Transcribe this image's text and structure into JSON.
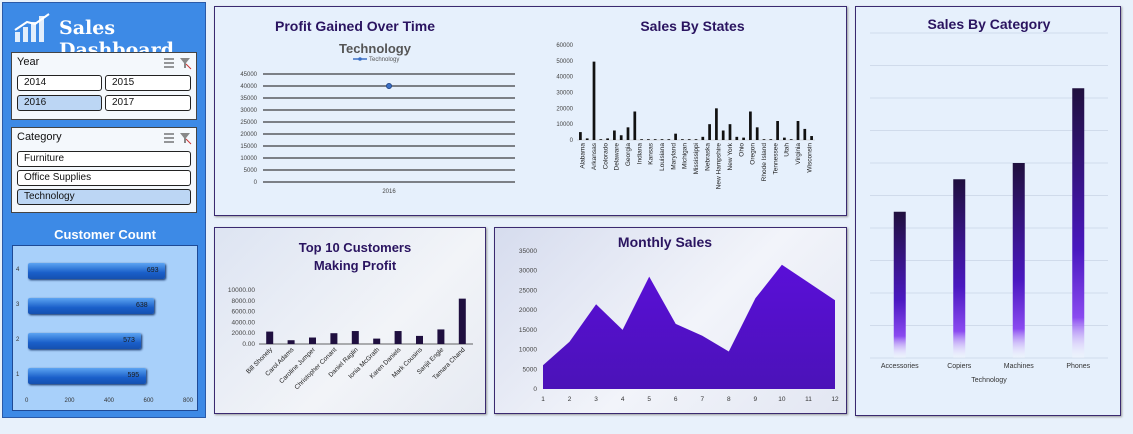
{
  "sidebar": {
    "title": "Sales Dashboard",
    "year_slicer": {
      "label": "Year",
      "items": [
        "2014",
        "2015",
        "2016",
        "2017"
      ],
      "selected": "2016"
    },
    "category_slicer": {
      "label": "Category",
      "items": [
        "Furniture",
        "Office Supplies",
        "Technology"
      ],
      "selected": "Technology"
    },
    "customer_count_title": "Customer Count"
  },
  "charts": {
    "customer_count": {
      "type": "bar",
      "orientation": "horizontal",
      "categories": [
        "4",
        "3",
        "2",
        "1"
      ],
      "values": [
        693,
        638,
        573,
        595
      ],
      "xticks": [
        "0",
        "200",
        "400",
        "600",
        "800"
      ],
      "xlim": [
        0,
        800
      ]
    },
    "profit_over_time": {
      "type": "line",
      "title": "Profit Gained Over Time",
      "chart_title": "Technology",
      "legend": "Technology",
      "x": [
        "2016"
      ],
      "values": [
        40000
      ],
      "ylim": [
        0,
        45000
      ],
      "yticks": [
        "45000",
        "40000",
        "35000",
        "30000",
        "25000",
        "20000",
        "15000",
        "10000",
        "5000",
        "0"
      ]
    },
    "sales_by_states": {
      "type": "bar",
      "title": "Sales By States",
      "ylim": [
        0,
        60000
      ],
      "yticks": [
        "60000",
        "50000",
        "40000",
        "30000",
        "20000",
        "10000",
        "0"
      ],
      "labels": [
        "Alabama",
        "Arkansas",
        "Colorado",
        "Delaware",
        "Georgia",
        "Indiana",
        "Kansas",
        "Louisiana",
        "Maryland",
        "Michigan",
        "Mississippi",
        "Nebraska",
        "New Hampshire",
        "New York",
        "Ohio",
        "Oregon",
        "Rhode Island",
        "Tennessee",
        "Utah",
        "Virginia",
        "Wisconsin"
      ],
      "values": [
        5000,
        1000,
        49500,
        500,
        1000,
        6000,
        3000,
        8000,
        18000,
        500,
        500,
        500,
        500,
        500,
        4000,
        500,
        500,
        500,
        2000,
        10000,
        20000,
        6000,
        10000,
        2000,
        1500,
        18000,
        8000,
        500,
        500,
        12000,
        1500,
        500,
        12000,
        7000,
        2500
      ]
    },
    "sales_by_category": {
      "type": "bar",
      "title": "Sales By Category",
      "categories": [
        "Accessories",
        "Copiers",
        "Machines",
        "Phones"
      ],
      "values": [
        45,
        55,
        60,
        83
      ],
      "xlabel": "Technology",
      "ylim": [
        0,
        100
      ]
    },
    "top_customers": {
      "type": "bar",
      "title_line1": "Top 10 Customers",
      "title_line2": "Making Profit",
      "categories": [
        "Bill Shonely",
        "Carol Adams",
        "Caroline Jumper",
        "Christopher Conant",
        "Daniel Raglin",
        "Ionia McGrath",
        "Karen Daniels",
        "Mark Cousins",
        "Sanjit Engle",
        "Tamara Chand"
      ],
      "values": [
        2300,
        700,
        1200,
        2000,
        2400,
        1000,
        2400,
        1500,
        2700,
        8400
      ],
      "ylim": [
        0,
        10000
      ],
      "yticks": [
        "10000.00",
        "8000.00",
        "6000.00",
        "4000.00",
        "2000.00",
        "0.00"
      ]
    },
    "monthly_sales": {
      "type": "area",
      "title": "Monthly Sales",
      "x": [
        "1",
        "2",
        "3",
        "4",
        "5",
        "6",
        "7",
        "8",
        "9",
        "10",
        "11",
        "12"
      ],
      "values": [
        6000,
        12000,
        21500,
        15000,
        28500,
        16500,
        13500,
        9500,
        23000,
        31500,
        27000,
        22500
      ],
      "ylim": [
        0,
        35000
      ],
      "yticks": [
        "35000",
        "30000",
        "25000",
        "20000",
        "15000",
        "10000",
        "5000",
        "0"
      ]
    }
  },
  "colors": {
    "sidebar": "#3d8ae6",
    "dark_bar": "#1f0f3f",
    "purple": "#5a0fd8",
    "title": "#2a1460"
  }
}
